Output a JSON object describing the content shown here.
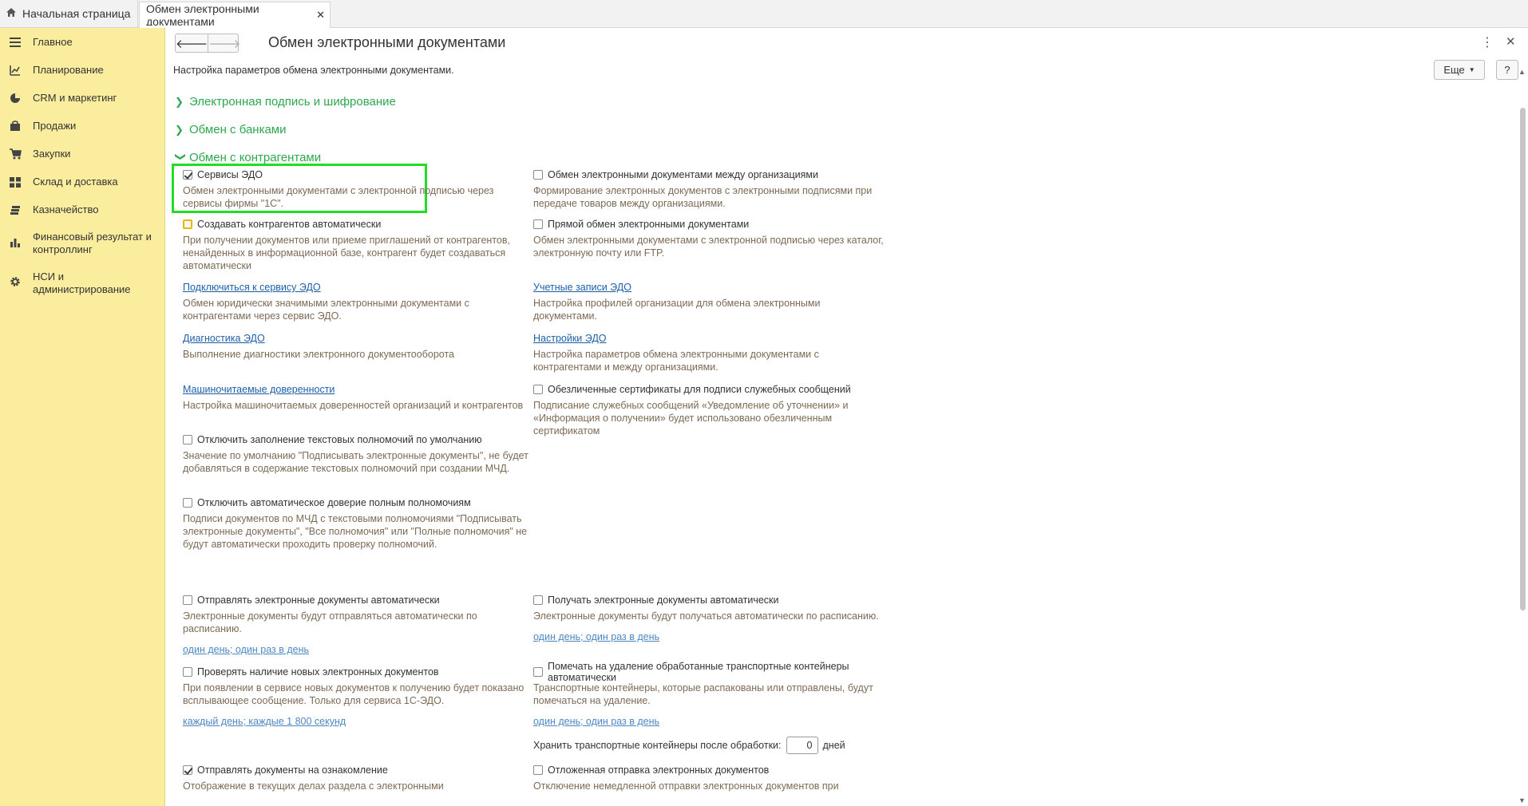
{
  "tabs": {
    "home_label": "Начальная страница",
    "active_label": "Обмен электронными документами"
  },
  "sidebar": {
    "items": [
      {
        "label": "Главное",
        "icon": "menu-lines-icon"
      },
      {
        "label": "Планирование",
        "icon": "planning-icon"
      },
      {
        "label": "CRM и маркетинг",
        "icon": "pie-chart-icon"
      },
      {
        "label": "Продажи",
        "icon": "bag-icon"
      },
      {
        "label": "Закупки",
        "icon": "cart-icon"
      },
      {
        "label": "Склад и доставка",
        "icon": "warehouse-grid-icon"
      },
      {
        "label": "Казначейство",
        "icon": "coins-icon"
      },
      {
        "label": "Финансовый результат и контроллинг",
        "icon": "bar-chart-icon"
      },
      {
        "label": "НСИ и администрирование",
        "icon": "gear-icon"
      }
    ]
  },
  "header": {
    "title": "Обмен электронными документами",
    "subtitle": "Настройка параметров обмена электронными документами.",
    "more_label": "Еще",
    "help_label": "?"
  },
  "groups": {
    "signature": "Электронная подпись и шифрование",
    "banks": "Обмен с банками",
    "counterparties": "Обмен с контрагентами"
  },
  "settings": {
    "edo_services": {
      "label": "Сервисы ЭДО",
      "checked": true,
      "desc": "Обмен электронными документами с электронной подписью через сервисы фирмы \"1С\"."
    },
    "between_orgs": {
      "label": "Обмен электронными документами между организациями",
      "checked": false,
      "desc": "Формирование электронных документов с электронными подписями при передаче товаров между организациями."
    },
    "auto_counterparties": {
      "label": "Создавать контрагентов автоматически",
      "checked": false,
      "desc": "При получении документов или приеме приглашений от контрагентов, ненайденных в информационной базе, контрагент будет создаваться автоматически"
    },
    "direct_exchange": {
      "label": "Прямой обмен электронными документами",
      "checked": false,
      "desc": "Обмен электронными документами с электронной подписью через каталог, электронную почту или FTP."
    },
    "connect_service": {
      "link": "Подключиться к сервису ЭДО",
      "desc": "Обмен юридически значимыми электронными документами с контрагентами через сервис ЭДО."
    },
    "accounts": {
      "link": "Учетные записи ЭДО",
      "desc": "Настройка профилей организации для обмена электронными документами."
    },
    "diagnostics": {
      "link": "Диагностика ЭДО",
      "desc": "Выполнение диагностики электронного документооборота"
    },
    "edo_settings": {
      "link": "Настройки ЭДО",
      "desc": "Настройка параметров обмена электронными документами с контрагентами и между организациями."
    },
    "machine_poa": {
      "link": "Машиночитаемые доверенности",
      "desc": "Настройка машиночитаемых доверенностей организаций и контрагентов"
    },
    "impersonal_certs": {
      "label": "Обезличенные сертификаты для подписи служебных сообщений",
      "checked": false,
      "desc": "Подписание служебных сообщений «Уведомление об уточнении» и «Информация о получении» будет использовано обезличенным сертификатом"
    },
    "disable_text_powers": {
      "label": "Отключить заполнение текстовых полномочий по умолчанию",
      "checked": false,
      "desc": "Значение по умолчанию \"Подписывать электронные документы\", не будет добавляться в содержание текстовых полномочий при создании МЧД."
    },
    "disable_auto_trust": {
      "label": "Отключить автоматическое доверие полным полномочиям",
      "checked": false,
      "desc": "Подписи документов по МЧД с текстовыми полномочиями \"Подписывать электронные документы\", \"Все полномочия\" или \"Полные полномочия\" не будут автоматически проходить проверку полномочий."
    },
    "send_auto": {
      "label": "Отправлять электронные документы автоматически",
      "checked": false,
      "desc": "Электронные документы будут отправляться автоматически по расписанию.",
      "schedule": "один день; один раз в день"
    },
    "receive_auto": {
      "label": "Получать электронные документы автоматически",
      "checked": false,
      "desc": "Электронные документы будут получаться автоматически по расписанию.",
      "schedule": "один день; один раз в день"
    },
    "check_new": {
      "label": "Проверять наличие новых электронных документов",
      "checked": false,
      "desc": "При появлении в сервисе новых документов к получению будет показано всплывающее сообщение. Только для сервиса 1С-ЭДО.",
      "schedule": "каждый день; каждые 1 800 секунд"
    },
    "mark_delete": {
      "label": "Помечать на удаление обработанные транспортные контейнеры автоматически",
      "checked": false,
      "desc": "Транспортные контейнеры, которые распакованы или отправлены, будут помечаться на удаление.",
      "schedule": "один день; один раз в день"
    },
    "keep_containers": {
      "label": "Хранить транспортные контейнеры после обработки:",
      "value": "0",
      "unit": "дней"
    },
    "send_review": {
      "label": "Отправлять документы на ознакомление",
      "checked": true,
      "desc": "Отображение в текущих делах  раздела с электронными"
    },
    "deferred_send": {
      "label": "Отложенная отправка электронных документов",
      "checked": false,
      "desc": "Отключение немедленной отправки электронных документов при"
    }
  },
  "colors": {
    "sidebar_bg": "#fbed9e",
    "group_green": "#2ea84e",
    "link_blue": "#1f5fa8",
    "desc_brown": "#7d6a55",
    "highlight_green": "#22dd22"
  }
}
